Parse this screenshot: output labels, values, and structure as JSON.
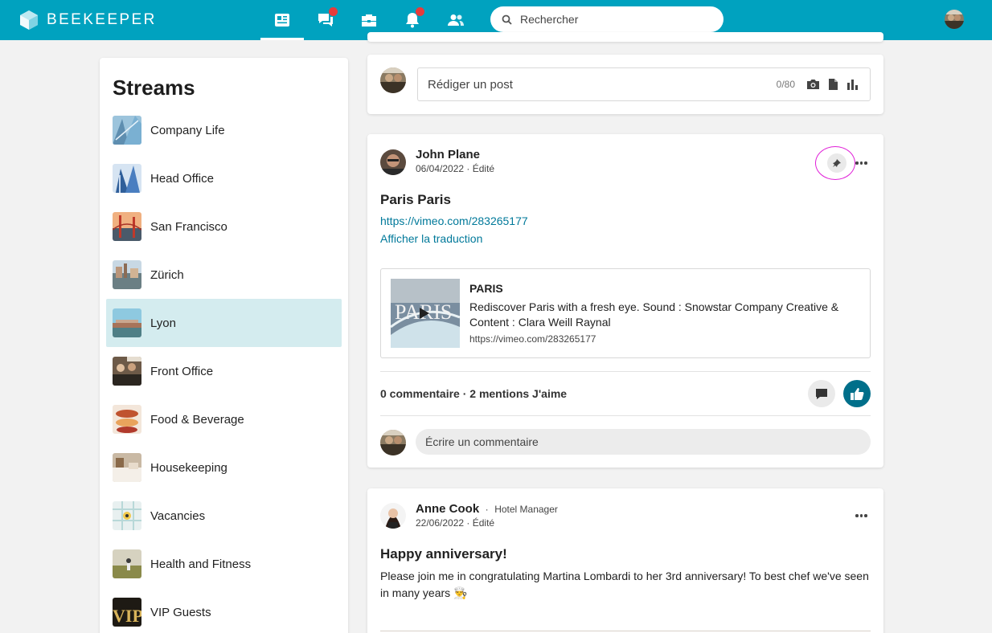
{
  "app": {
    "brand": "BEEKEEPER",
    "accent": "#00a2bf"
  },
  "nav": {
    "items": [
      {
        "icon": "news-feed-icon",
        "active": true
      },
      {
        "icon": "chat-icon",
        "badge": true
      },
      {
        "icon": "tools-icon"
      },
      {
        "icon": "bell-icon",
        "badge": true
      },
      {
        "icon": "people-icon"
      }
    ]
  },
  "search": {
    "placeholder": "Rechercher"
  },
  "streams": {
    "title": "Streams",
    "items": [
      {
        "label": "Company Life"
      },
      {
        "label": "Head Office"
      },
      {
        "label": "San Francisco"
      },
      {
        "label": "Zürich"
      },
      {
        "label": "Lyon",
        "active": true
      },
      {
        "label": "Front Office"
      },
      {
        "label": "Food & Beverage"
      },
      {
        "label": "Housekeeping"
      },
      {
        "label": "Vacancies"
      },
      {
        "label": "Health and Fitness"
      },
      {
        "label": "VIP Guests"
      }
    ]
  },
  "composer": {
    "placeholder": "Rédiger un post",
    "counter": "0/80"
  },
  "post1": {
    "author": "John Plane",
    "date": "06/04/2022",
    "edited": "Édité",
    "title": "Paris Paris",
    "link": "https://vimeo.com/283265177",
    "translate": "Afficher la traduction",
    "preview": {
      "title": "PARIS",
      "description": "Rediscover Paris with a fresh eye. Sound : Snowstar Company Creative & Content : Clara Weill Raynal",
      "url": "https://vimeo.com/283265177"
    },
    "stats": "0 commentaire · 2 mentions J'aime",
    "comment_placeholder": "Écrire un commentaire",
    "highlight_color": "#e020d8"
  },
  "post2": {
    "author": "Anne Cook",
    "role": "Hotel Manager",
    "date": "22/06/2022",
    "edited": "Édité",
    "title": "Happy anniversary!",
    "body": "Please join me in congratulating Martina Lombardi to her 3rd anniversary! To best chef we've seen in many years 👨‍🍳"
  }
}
